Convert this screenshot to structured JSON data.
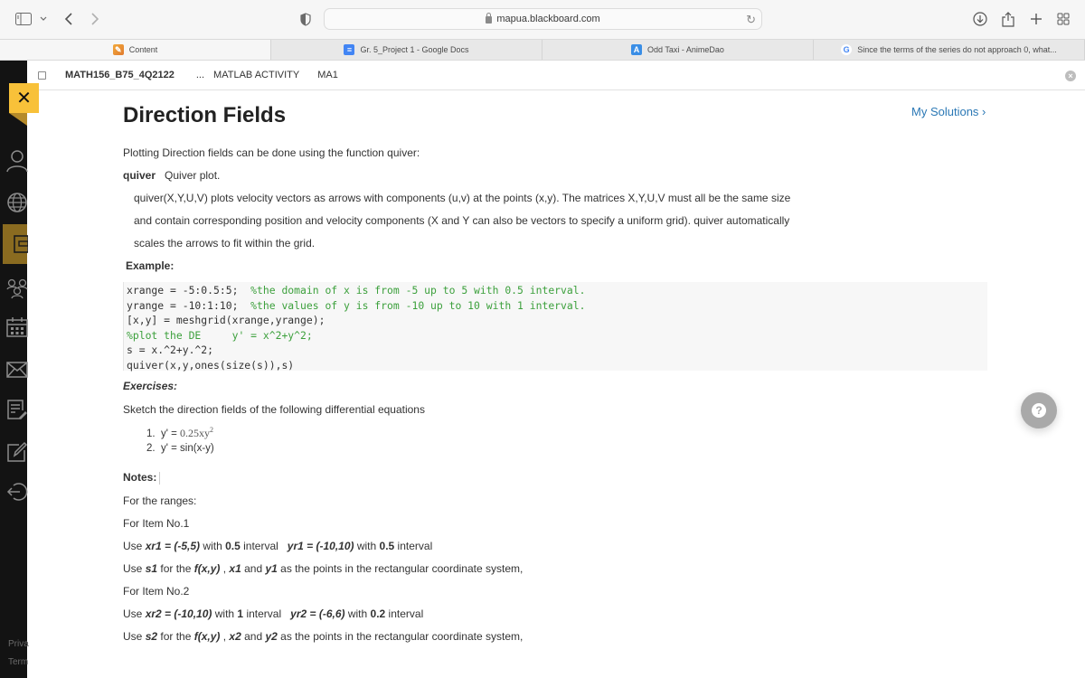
{
  "browser": {
    "url": "mapua.blackboard.com",
    "tabs": [
      {
        "label": "Content",
        "icon": "pencil-icon",
        "active": true
      },
      {
        "label": "Gr. 5_Project 1 - Google Docs",
        "icon": "google-docs-icon",
        "active": false
      },
      {
        "label": "Odd Taxi - AnimeDao",
        "icon": "animedao-icon",
        "active": false
      },
      {
        "label": "Since the terms of the series do not approach 0, what...",
        "icon": "google-icon",
        "active": false
      }
    ]
  },
  "leftnav": {
    "items": [
      "profile-icon",
      "globe-icon",
      "courses-icon",
      "groups-icon",
      "calendar-icon",
      "messages-icon",
      "grades-icon",
      "edit-icon",
      "sign-out-icon"
    ],
    "active_index": 2,
    "footer": [
      "Priva",
      "Term"
    ],
    "close_symbol": "✕"
  },
  "breadcrumb": {
    "course": "MATH156_B75_4Q2122",
    "ellipsis": "...",
    "items": [
      "MATLAB ACTIVITY",
      "MA1"
    ]
  },
  "page": {
    "title": "Direction Fields",
    "my_solutions": "My Solutions ›",
    "intro": "Plotting Direction fields can be done using the function quiver:",
    "quiver_term": "quiver",
    "quiver_desc": "Quiver plot.",
    "desc_lines": [
      "quiver(X,Y,U,V) plots velocity vectors as arrows with components (u,v) at the points (x,y).  The matrices X,Y,U,V must all be the same size",
      "and contain corresponding position and velocity components (X and Y  can also be vectors to specify a uniform grid).  quiver automatically",
      "scales the arrows to fit within the grid."
    ],
    "example_label": "Example:",
    "code": [
      {
        "code": "xrange = -5:0.5:5;  ",
        "comment": "%the domain of x is from -5 up to 5 with 0.5 interval."
      },
      {
        "code": "yrange = -10:1:10;  ",
        "comment": "%the values of y is from -10 up to 10 with 1 interval."
      },
      {
        "code": "[x,y] = meshgrid(xrange,yrange);",
        "comment": ""
      },
      {
        "code": "",
        "comment": "%plot the DE     y' = x^2+y^2;"
      },
      {
        "code": "s = x.^2+y.^2;",
        "comment": ""
      },
      {
        "code": "quiver(x,y,ones(size(s)),s)",
        "comment": ""
      }
    ],
    "exercises_label": "Exercises:",
    "exercises_intro": "Sketch the direction fields of the following differential equations",
    "exercises": [
      {
        "num": "1.",
        "prefix": "y' = ",
        "expr": "0.25xy",
        "sup": "2"
      },
      {
        "num": "2.",
        "prefix": "y' = ",
        "expr": "sin(x-y)",
        "sup": ""
      }
    ],
    "notes_label": "Notes:",
    "ranges_label": "For the ranges:",
    "item1_label": "For Item No.1",
    "item1_line1": {
      "use": "Use ",
      "xr": "xr1 = (-5,5)",
      "with1": " with ",
      "xint": "0.5",
      "int1": " interval   ",
      "yr": "yr1 = (-10,10)",
      "with2": " with ",
      "yint": "0.5",
      "int2": " interval"
    },
    "item1_line2": {
      "use": "Use ",
      "s": "s1",
      "t1": " for the ",
      "f": "f(x,y)",
      "t2": " , ",
      "x": "x1",
      "t3": " and ",
      "y": "y1",
      "t4": " as the points in the rectangular coordinate system,"
    },
    "item2_label": "For Item No.2",
    "item2_line1": {
      "use": "Use ",
      "xr": "xr2 = (-10,10)",
      "with1": " with ",
      "xint": "1",
      "int1": " interval   ",
      "yr": "yr2 = (-6,6)",
      "with2": " with ",
      "yint": "0.2",
      "int2": " interval"
    },
    "item2_line2": {
      "use": "Use ",
      "s": "s2",
      "t1": " for the ",
      "f": "f(x,y)",
      "t2": " , ",
      "x": "x2",
      "t3": " and ",
      "y": "y2",
      "t4": " as the points in the rectangular coordinate system,"
    }
  },
  "help": {
    "symbol": "?"
  },
  "colors": {
    "accent_yellow": "#f8c139",
    "link_blue": "#2b78b5",
    "comment_green": "#3ca03c",
    "nav_bg": "#131313"
  }
}
